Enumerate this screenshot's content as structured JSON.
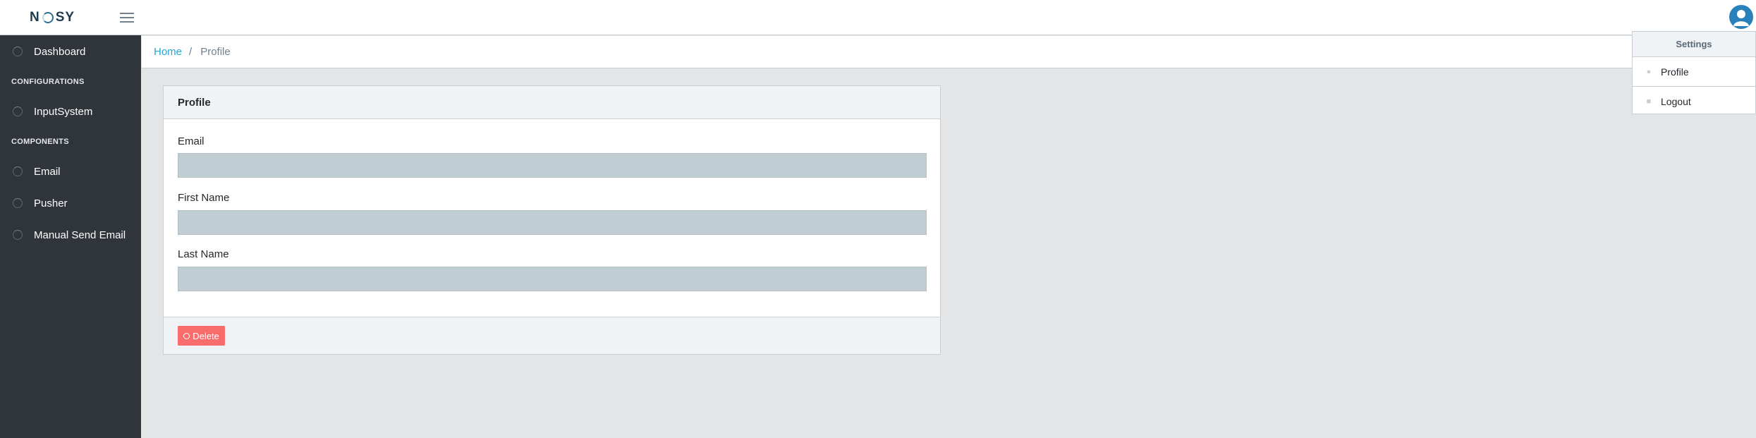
{
  "header": {
    "logo_left": "N",
    "logo_right": "SY"
  },
  "sidebar": {
    "items": [
      {
        "label": "Dashboard"
      },
      {
        "label": "InputSystem"
      },
      {
        "label": "Email"
      },
      {
        "label": "Pusher"
      },
      {
        "label": "Manual Send Email"
      }
    ],
    "sections": [
      "CONFIGURATIONS",
      "COMPONENTS"
    ]
  },
  "breadcrumb": {
    "home": "Home",
    "separator": "/",
    "current": "Profile"
  },
  "card": {
    "title": "Profile",
    "fields": [
      {
        "label": "Email",
        "value": ""
      },
      {
        "label": "First Name",
        "value": ""
      },
      {
        "label": "Last Name",
        "value": ""
      }
    ],
    "delete_label": "Delete"
  },
  "dropdown": {
    "header": "Settings",
    "items": [
      {
        "label": "Profile",
        "icon": "user-icon"
      },
      {
        "label": "Logout",
        "icon": "lock-icon"
      }
    ]
  },
  "colors": {
    "sidebar_bg": "#2f353a",
    "link": "#20a8d8",
    "danger": "#f86c6b",
    "avatar": "#2a80b9"
  }
}
